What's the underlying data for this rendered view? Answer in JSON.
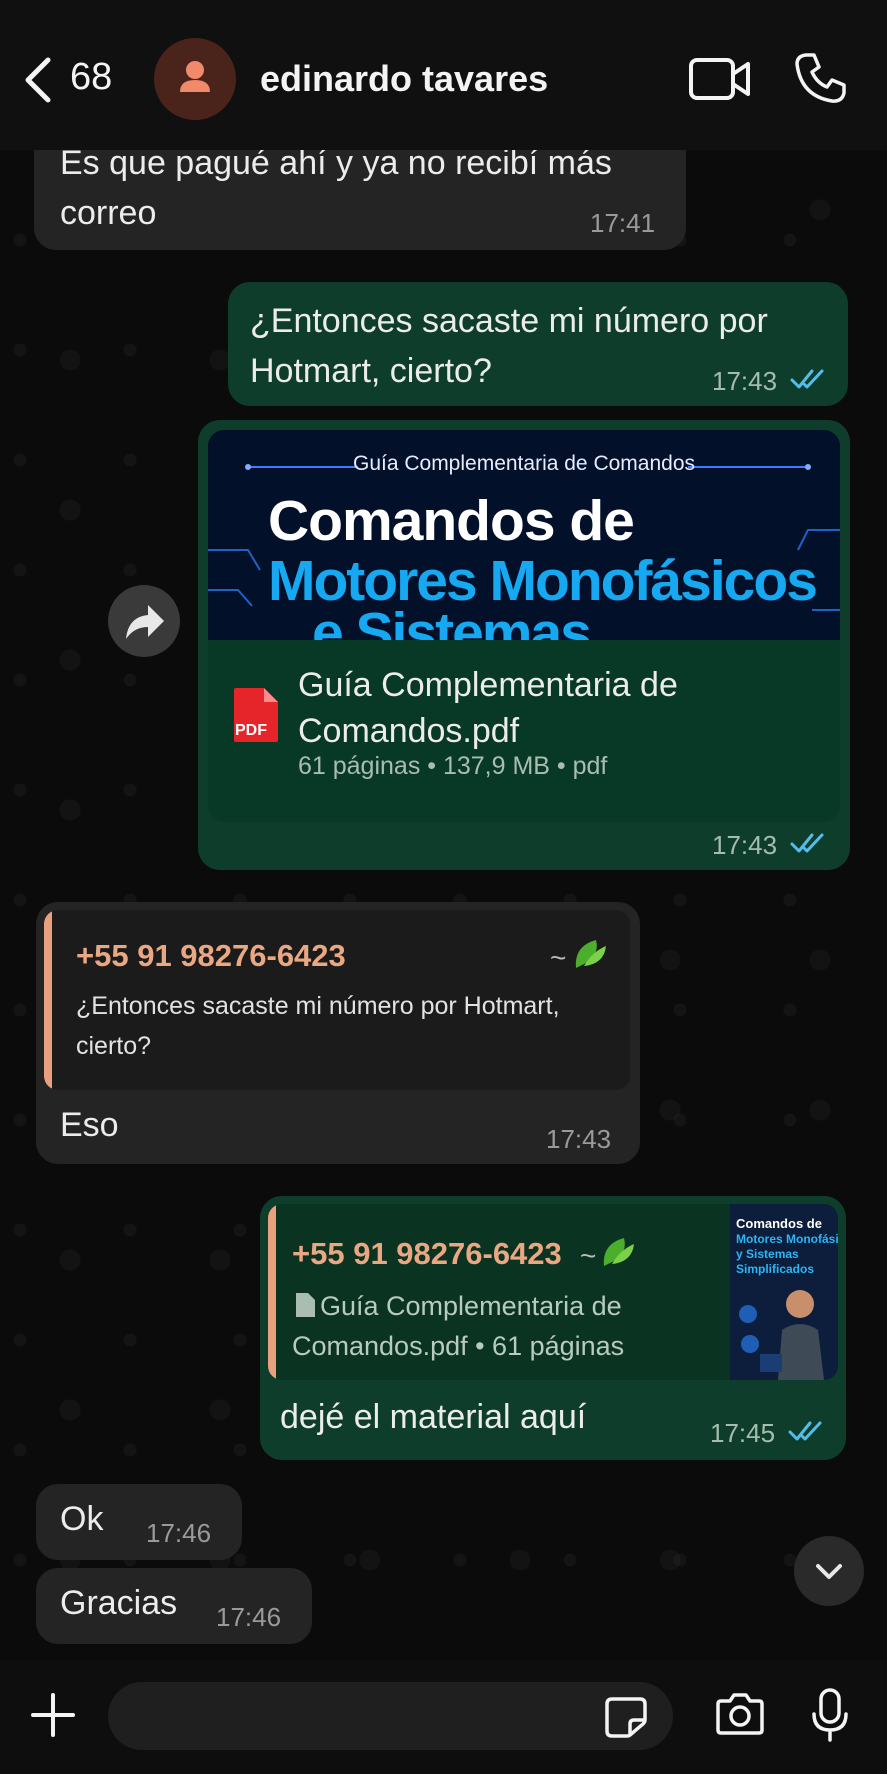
{
  "header": {
    "back_count": "68",
    "contact_name": "edinardo tavares"
  },
  "messages": {
    "m1": {
      "text": "Es que pagué ahí y ya no recibí más correo",
      "line1": "Es que pagué ahí y ya no recibí más",
      "line2": "correo",
      "time": "17:41"
    },
    "m2": {
      "line1": "¿Entonces sacaste mi número por",
      "line2": "Hotmart, cierto?",
      "time": "17:43"
    },
    "m3": {
      "banner_sub": "Guía Complementaria de Comandos",
      "banner_line1": "Comandos de",
      "banner_line2": "Motores Monofásicos",
      "banner_line3": "e Sistemas",
      "pdf_badge": "PDF",
      "file_line1": "Guía Complementaria de",
      "file_line2": "Comandos.pdf",
      "meta": "61 páginas • 137,9 MB • pdf",
      "time": "17:43"
    },
    "m4": {
      "quote_number": "+55 91 98276-6423",
      "quote_tilde": "~",
      "quote_line1": "¿Entonces sacaste mi número por Hotmart,",
      "quote_line2": "cierto?",
      "text": "Eso",
      "time": "17:43"
    },
    "m5": {
      "quote_number": "+55 91 98276-6423",
      "quote_tilde": "~",
      "quote_line1": "Guía Complementaria de",
      "quote_line2": "Comandos.pdf • 61 páginas",
      "thumb_title1": "Comandos de",
      "thumb_title2": "Motores Monofásicos",
      "thumb_title3": "y Sistemas",
      "thumb_title4": "Simplificados",
      "text": "dejé el material aquí",
      "time": "17:45"
    },
    "m6": {
      "text": "Ok",
      "time": "17:46"
    },
    "m7": {
      "text": "Gracias",
      "time": "17:46"
    }
  },
  "colors": {
    "incoming_bubble": "#242424",
    "outgoing_bubble": "#0e3e2b",
    "read_ticks": "#53bdeb",
    "quote_accent": "#e9a07f"
  },
  "icons": [
    "chevron-left-icon",
    "person-icon",
    "video-call-icon",
    "phone-icon",
    "forward-icon",
    "pdf-icon",
    "double-check-icon",
    "chevron-down-icon",
    "plus-icon",
    "sticker-icon",
    "camera-icon",
    "microphone-icon"
  ]
}
